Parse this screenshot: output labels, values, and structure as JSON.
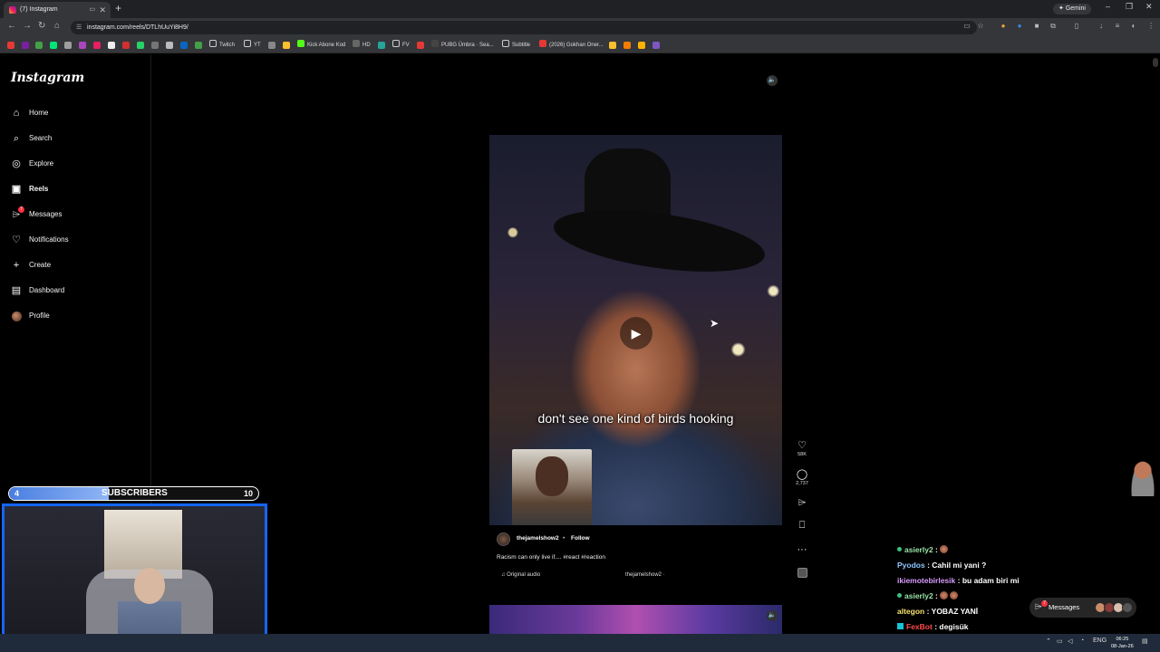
{
  "browser": {
    "tab_title": "(7) Instagram",
    "url": "instagram.com/reels/DTLhUuYi8H9/",
    "gemini_label": "Gemini",
    "bookmarks": [
      "Twitch",
      "YT",
      "Kick Abone Kod",
      "HD",
      "FV",
      "PUBG Ümbra · Sea...",
      "Subtitle",
      "(2026) Gokhan Oner..."
    ]
  },
  "instagram": {
    "logo": "Instagram",
    "nav": [
      {
        "label": "Home",
        "icon": "home-icon"
      },
      {
        "label": "Search",
        "icon": "search-icon"
      },
      {
        "label": "Explore",
        "icon": "compass-icon"
      },
      {
        "label": "Reels",
        "icon": "reels-icon"
      },
      {
        "label": "Messages",
        "icon": "messenger-icon",
        "badge": "7"
      },
      {
        "label": "Notifications",
        "icon": "heart-icon"
      },
      {
        "label": "Create",
        "icon": "plus-icon"
      },
      {
        "label": "Dashboard",
        "icon": "chart-icon"
      },
      {
        "label": "Profile",
        "icon": "avatar"
      }
    ],
    "reel": {
      "caption_overlay": "don't see one kind of birds hooking",
      "username": "thejamelshow2",
      "separator": "•",
      "follow_label": "Follow",
      "description": "Racism can only live if.... #react #reaction",
      "audio_label": "Original audio",
      "audio_author": "thejamelshow2 ·",
      "likes": "58K",
      "comments": "2,737"
    },
    "messages_button": {
      "label": "Messages",
      "badge": "7"
    }
  },
  "stream": {
    "sub_goal": {
      "current": "4",
      "label": "SUBSCRIBERS",
      "goal": "10",
      "progress_fraction": 0.4
    },
    "chat": [
      {
        "user": "asierly2",
        "text": ":",
        "user_color": "#9be3a8",
        "badge": "sub",
        "emote": true
      },
      {
        "user": "Pyodos",
        "text": ": Cahil mi yani ?",
        "user_color": "#8ec5ff"
      },
      {
        "user": "ikiemotebirlesik",
        "text": ": bu adam biri mi",
        "user_color": "#d79cff"
      },
      {
        "user": "asierly2",
        "text": ":",
        "user_color": "#9be3a8",
        "badge": "sub",
        "emote": true,
        "emote2": true
      },
      {
        "user": "altegon",
        "text": ": YOBAZ YANİ",
        "user_color": "#f7e36b"
      },
      {
        "user": "FexBot",
        "text": ": degisük",
        "user_color": "#ff4a4a",
        "badge": "bot"
      }
    ]
  },
  "taskbar": {
    "lang": "ENG",
    "time": "06:25",
    "date": "08-Jan-26"
  },
  "colors": {
    "accent_blue": "#1565ff",
    "badge_red": "#ff3040"
  }
}
